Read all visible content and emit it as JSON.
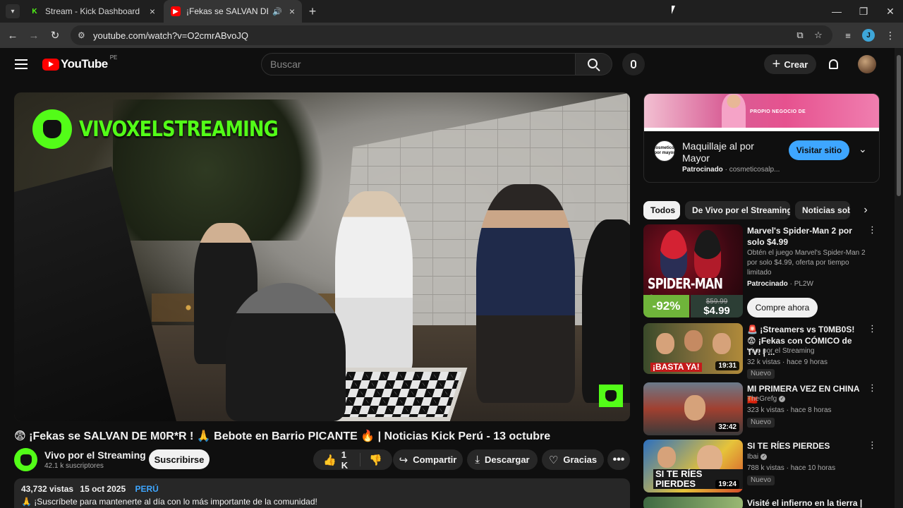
{
  "browser": {
    "tabs": [
      {
        "title": "Stream - Kick Dashboard",
        "favicon": "kick-icon",
        "active": false
      },
      {
        "title": "¡Fekas se SALVAN DE M",
        "favicon": "youtube-icon",
        "active": true,
        "audio": true
      }
    ],
    "url": "youtube.com/watch?v=O2cmrABvoJQ",
    "profile_initial": "J"
  },
  "masthead": {
    "logo_text": "YouTube",
    "country_code": "PE",
    "search_placeholder": "Buscar",
    "create_label": "Crear"
  },
  "video": {
    "watermark": "VIVOXELSTREAMING",
    "title": "😨 ¡Fekas se SALVAN DE M0R*R ! 🙏 Bebote en Barrio PICANTE 🔥 | Noticias Kick Perú - 13 octubre",
    "channel": "Vivo por el Streaming",
    "subscribers": "42.1 k suscriptores",
    "subscribe_label": "Suscribirse",
    "likes": "1 K",
    "share_label": "Compartir",
    "download_label": "Descargar",
    "thanks_label": "Gracias",
    "views": "43,732 vistas",
    "date": "15 oct 2025",
    "country_tag": "PERÚ",
    "description_line": "🙏 ¡Suscríbete para mantenerte al día con lo más importante de la comunidad!"
  },
  "ad": {
    "banner_text": "PROPIO NEGOCIO DE",
    "logo_text": "Cosmeticos por mayor",
    "title": "Maquillaje al por Mayor",
    "sponsored_label": "Patrocinado",
    "domain": "cosmeticosalp...",
    "visit_label": "Visitar sitio"
  },
  "chips": [
    {
      "label": "Todos",
      "active": true
    },
    {
      "label": "De Vivo por el Streaming",
      "active": false
    },
    {
      "label": "Noticias sob",
      "active": false
    }
  ],
  "recommendations": [
    {
      "type": "promoted",
      "title": "Marvel's Spider-Man 2 por solo $4.99",
      "description": "Obtén el juego Marvel's Spider-Man 2 por solo $4.99, oferta por tiempo limitado",
      "sponsored_label": "Patrocinado",
      "advertiser": "PL2W",
      "cta": "Compre ahora",
      "thumb_logo": "SPIDER-MAN 2",
      "thumb_discount": "-92%",
      "thumb_old_price": "$59.99",
      "thumb_price": "$4.99"
    },
    {
      "title": "🚨 ¡Streamers vs T0MB0S! 😨 ¡Fekas con CÓMICO de TV! | ...",
      "channel": "Vivo por el Streaming",
      "meta": "32 k vistas · hace 9 horas",
      "badge": "Nuevo",
      "duration": "19:31",
      "thumb_text": "¡BASTA YA!"
    },
    {
      "title": "MI PRIMERA VEZ EN CHINA 🇨🇳",
      "channel": "TheGrefg",
      "verified": true,
      "meta": "323 k vistas · hace 8 horas",
      "badge": "Nuevo",
      "duration": "32:42"
    },
    {
      "title": "SI TE RÍES PIERDES",
      "channel": "Ibai",
      "verified": true,
      "meta": "788 k vistas · hace 10 horas",
      "badge": "Nuevo",
      "duration": "19:24",
      "thumb_text": "SI TE RÍES PIERDES"
    },
    {
      "title": "Visité el infierno en la tierra |"
    }
  ],
  "colors": {
    "kick_green": "#53fc18",
    "youtube_red": "#ff0000",
    "link_blue": "#3ea6ff",
    "background": "#0f0f0f"
  }
}
